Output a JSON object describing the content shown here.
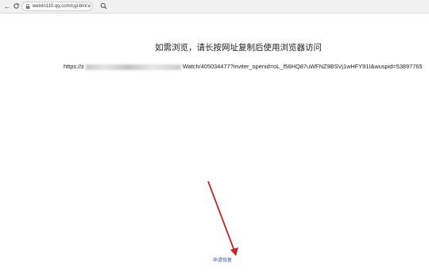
{
  "browser": {
    "url": "weixin110.qq.com/cgi-bin/...",
    "icons": [
      "back-arrow-icon",
      "reload-icon",
      "lock-icon",
      "close-icon",
      "search-icon"
    ],
    "close_glyph": "×"
  },
  "page": {
    "instruction": "如需浏览，请长按网址复制后使用浏览器访问",
    "url_prefix": "https://z",
    "url_suffix": "Watch/405034477?inviter_openid=oL_f56HQ87uWFNZ9BSVj1wHFY91I&wuspid=53897765",
    "bottom_link": "申请恢复"
  },
  "colors": {
    "link": "#3b5998",
    "arrow": "#c0262d"
  }
}
